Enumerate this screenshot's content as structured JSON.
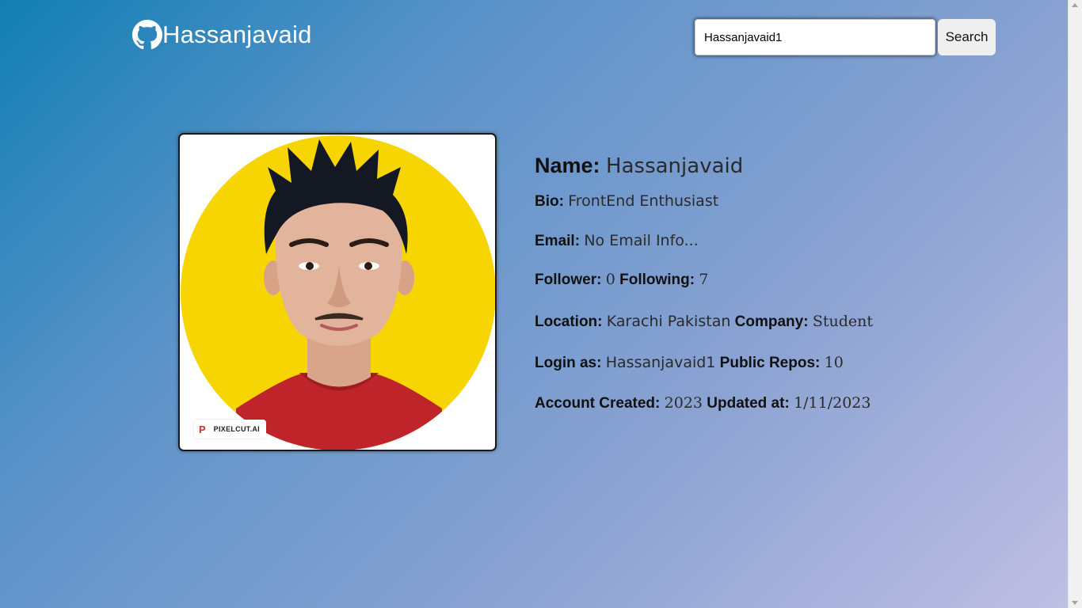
{
  "header": {
    "title": "Hassanjavaid",
    "logo_icon": "github-icon"
  },
  "search": {
    "value": "Hassanjavaid1",
    "button_label": "Search"
  },
  "avatar": {
    "watermark_logo": "P",
    "watermark_text": "PIXELCUT.AI",
    "background_color": "#f7d503"
  },
  "profile": {
    "name_label": "Name:",
    "name_value": "Hassanjavaid",
    "bio_label": "Bio:",
    "bio_value": "FrontEnd Enthusiast",
    "email_label": "Email:",
    "email_value": "No Email Info...",
    "follower_label": "Follower:",
    "follower_value": "0",
    "following_label": "Following:",
    "following_value": "7",
    "location_label": "Location:",
    "location_value": "Karachi Pakistan",
    "company_label": "Company:",
    "company_value": "Student",
    "login_label": "Login as:",
    "login_value": "Hassanjavaid1",
    "repos_label": "Public Repos:",
    "repos_value": "10",
    "created_label": "Account Created:",
    "created_value": "2023",
    "updated_label": "Updated at:",
    "updated_value": "1/11/2023"
  }
}
